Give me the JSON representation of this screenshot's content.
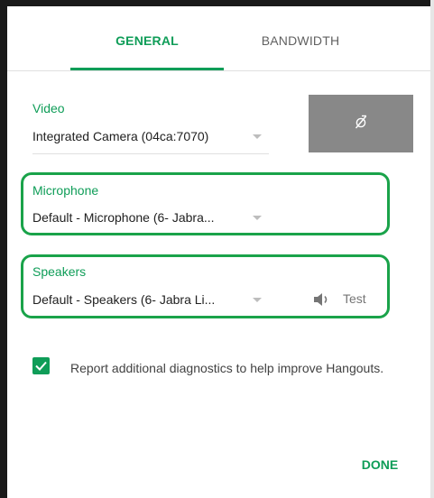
{
  "tabs": {
    "general": "GENERAL",
    "bandwidth": "BANDWIDTH",
    "active": "general"
  },
  "video": {
    "label": "Video",
    "selected": "Integrated Camera (04ca:7070)"
  },
  "microphone": {
    "label": "Microphone",
    "selected": "Default - Microphone (6- Jabra..."
  },
  "speakers": {
    "label": "Speakers",
    "selected": "Default - Speakers (6- Jabra Li...",
    "test_label": "Test"
  },
  "diagnostics": {
    "checked": true,
    "text": "Report additional diagnostics to help improve Hangouts."
  },
  "footer": {
    "done_label": "DONE"
  },
  "icons": {
    "camera_preview": "camera-off-icon",
    "test": "speaker-icon",
    "dropdown": "caret-down-icon",
    "checkbox": "checkmark-icon"
  },
  "colors": {
    "accent": "#0f9d58",
    "highlight": "#1aa34a",
    "preview_bg": "#888888"
  }
}
